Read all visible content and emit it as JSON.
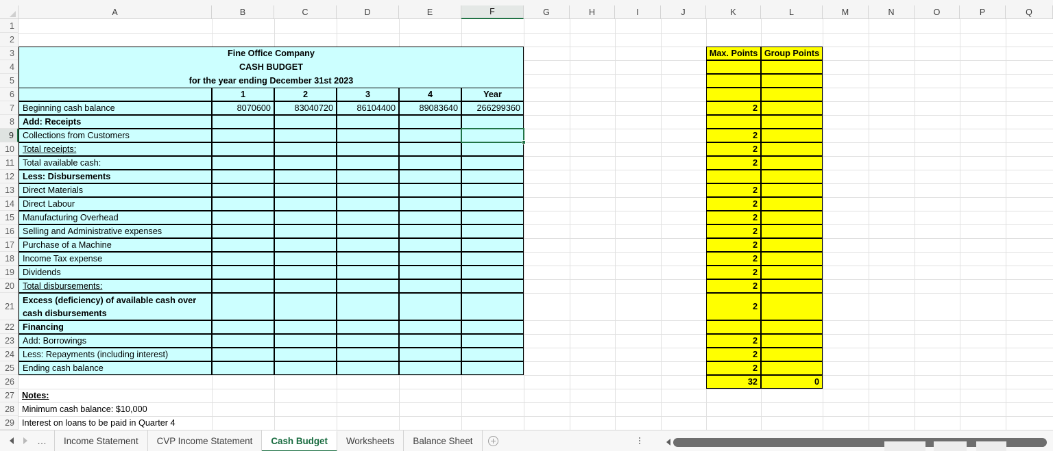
{
  "app": {
    "type": "spreadsheet",
    "selected_cell": "F9",
    "selected_column_header": "F",
    "selected_row_header": "9",
    "colors": {
      "budget_fill": "#ccffff",
      "points_fill": "#ffff00",
      "accent": "#217346",
      "grid": "#e0e0e0"
    }
  },
  "columns": [
    "A",
    "B",
    "C",
    "D",
    "E",
    "F",
    "G",
    "H",
    "I",
    "J",
    "K",
    "L",
    "M",
    "N",
    "O",
    "P",
    "Q"
  ],
  "rows": [
    "1",
    "2",
    "3",
    "4",
    "5",
    "6",
    "7",
    "8",
    "9",
    "10",
    "11",
    "12",
    "13",
    "14",
    "15",
    "16",
    "17",
    "18",
    "19",
    "20",
    "21",
    "22",
    "23",
    "24",
    "25",
    "26",
    "27",
    "28",
    "29"
  ],
  "budget": {
    "title_line1": "Fine Office Company",
    "title_line2": "CASH BUDGET",
    "title_line3": "for the year ending December 31st 2023",
    "column_headers": [
      "1",
      "2",
      "3",
      "4",
      "Year"
    ],
    "rows": [
      {
        "row": "7",
        "label": "Beginning cash balance",
        "bold": false,
        "underline": false,
        "values": [
          "8070600",
          "83040720",
          "86104400",
          "89083640",
          "266299360"
        ]
      },
      {
        "row": "8",
        "label": "Add: Receipts",
        "bold": true,
        "underline": false,
        "values": [
          "",
          "",
          "",
          "",
          ""
        ]
      },
      {
        "row": "9",
        "label": "Collections from Customers",
        "bold": false,
        "underline": false,
        "values": [
          "",
          "",
          "",
          "",
          ""
        ]
      },
      {
        "row": "10",
        "label": "Total receipts:",
        "bold": false,
        "underline": true,
        "values": [
          "",
          "",
          "",
          "",
          ""
        ]
      },
      {
        "row": "11",
        "label": "Total available cash:",
        "bold": false,
        "underline": false,
        "values": [
          "",
          "",
          "",
          "",
          ""
        ]
      },
      {
        "row": "12",
        "label": "Less: Disbursements",
        "bold": true,
        "underline": false,
        "values": [
          "",
          "",
          "",
          "",
          ""
        ]
      },
      {
        "row": "13",
        "label": "Direct Materials",
        "bold": false,
        "underline": false,
        "values": [
          "",
          "",
          "",
          "",
          ""
        ]
      },
      {
        "row": "14",
        "label": "Direct Labour",
        "bold": false,
        "underline": false,
        "values": [
          "",
          "",
          "",
          "",
          ""
        ]
      },
      {
        "row": "15",
        "label": "Manufacturing Overhead",
        "bold": false,
        "underline": false,
        "values": [
          "",
          "",
          "",
          "",
          ""
        ]
      },
      {
        "row": "16",
        "label": "Selling and Administrative expenses",
        "bold": false,
        "underline": false,
        "values": [
          "",
          "",
          "",
          "",
          ""
        ]
      },
      {
        "row": "17",
        "label": "Purchase of a Machine",
        "bold": false,
        "underline": false,
        "values": [
          "",
          "",
          "",
          "",
          ""
        ]
      },
      {
        "row": "18",
        "label": "Income Tax expense",
        "bold": false,
        "underline": false,
        "values": [
          "",
          "",
          "",
          "",
          ""
        ]
      },
      {
        "row": "19",
        "label": "Dividends",
        "bold": false,
        "underline": false,
        "values": [
          "",
          "",
          "",
          "",
          ""
        ]
      },
      {
        "row": "20",
        "label": "Total disbursements:",
        "bold": false,
        "underline": true,
        "values": [
          "",
          "",
          "",
          "",
          ""
        ]
      },
      {
        "row": "21",
        "label": "Excess (deficiency) of available cash over cash disbursements",
        "bold": true,
        "underline": false,
        "values": [
          "",
          "",
          "",
          "",
          ""
        ]
      },
      {
        "row": "22",
        "label": "Financing",
        "bold": true,
        "underline": false,
        "values": [
          "",
          "",
          "",
          "",
          ""
        ]
      },
      {
        "row": "23",
        "label": "Add: Borrowings",
        "bold": false,
        "underline": false,
        "values": [
          "",
          "",
          "",
          "",
          ""
        ]
      },
      {
        "row": "24",
        "label": "Less: Repayments (including interest)",
        "bold": false,
        "underline": false,
        "values": [
          "",
          "",
          "",
          "",
          ""
        ]
      },
      {
        "row": "25",
        "label": "Ending cash balance",
        "bold": false,
        "underline": false,
        "values": [
          "",
          "",
          "",
          "",
          ""
        ]
      }
    ]
  },
  "notes": {
    "heading": "Notes:",
    "lines": [
      "Minimum cash balance: $10,000",
      "Interest on loans to be paid in Quarter 4"
    ]
  },
  "points_table": {
    "headers": [
      "Max. Points",
      "Group Points"
    ],
    "rows": [
      {
        "row": "4",
        "max": "",
        "group": ""
      },
      {
        "row": "5",
        "max": "",
        "group": ""
      },
      {
        "row": "6",
        "max": "",
        "group": ""
      },
      {
        "row": "7",
        "max": "2",
        "group": ""
      },
      {
        "row": "8",
        "max": "",
        "group": ""
      },
      {
        "row": "9",
        "max": "2",
        "group": ""
      },
      {
        "row": "10",
        "max": "2",
        "group": ""
      },
      {
        "row": "11",
        "max": "2",
        "group": ""
      },
      {
        "row": "12",
        "max": "",
        "group": ""
      },
      {
        "row": "13",
        "max": "2",
        "group": ""
      },
      {
        "row": "14",
        "max": "2",
        "group": ""
      },
      {
        "row": "15",
        "max": "2",
        "group": ""
      },
      {
        "row": "16",
        "max": "2",
        "group": ""
      },
      {
        "row": "17",
        "max": "2",
        "group": ""
      },
      {
        "row": "18",
        "max": "2",
        "group": ""
      },
      {
        "row": "19",
        "max": "2",
        "group": ""
      },
      {
        "row": "20",
        "max": "2",
        "group": ""
      },
      {
        "row": "21",
        "max": "2",
        "group": ""
      },
      {
        "row": "22",
        "max": "",
        "group": ""
      },
      {
        "row": "23",
        "max": "2",
        "group": ""
      },
      {
        "row": "24",
        "max": "2",
        "group": ""
      },
      {
        "row": "25",
        "max": "2",
        "group": ""
      },
      {
        "row": "26",
        "max": "32",
        "group": "0"
      }
    ]
  },
  "sheet_tabs": {
    "overflow_label": "…",
    "items": [
      {
        "label": "Income Statement",
        "active": false
      },
      {
        "label": "CVP Income Statement",
        "active": false
      },
      {
        "label": "Cash Budget",
        "active": true
      },
      {
        "label": "Worksheets",
        "active": false
      },
      {
        "label": "Balance Sheet",
        "active": false
      }
    ]
  }
}
